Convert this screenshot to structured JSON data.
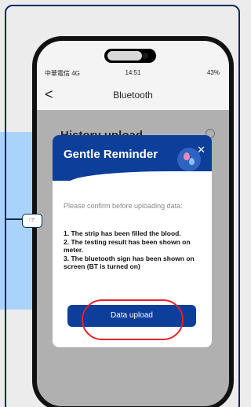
{
  "status_bar": {
    "carrier": "中華電信 4G",
    "time": "14:51",
    "battery": "43%"
  },
  "nav": {
    "back": "<",
    "title": "Bluetooth"
  },
  "background": {
    "history_title": "History upload"
  },
  "dialog": {
    "title": "Gentle Reminder",
    "close": "✕",
    "confirm_text": "Please confirm before uploading data:",
    "steps": [
      "1. The strip has been filled the blood.",
      "2. The testing result has been shown on meter.",
      "3. The bluetooth sign has been shown on screen (BT is turned on)"
    ],
    "upload_label": "Data upload"
  },
  "colors": {
    "brand": "#0d3e9a",
    "highlight": "#e0242a",
    "accent": "#a9d3fb"
  },
  "icons": {
    "pointer": "pointing-hand-icon",
    "drop": "blood-drop-icon",
    "close": "close-icon",
    "back": "chevron-left-icon"
  }
}
